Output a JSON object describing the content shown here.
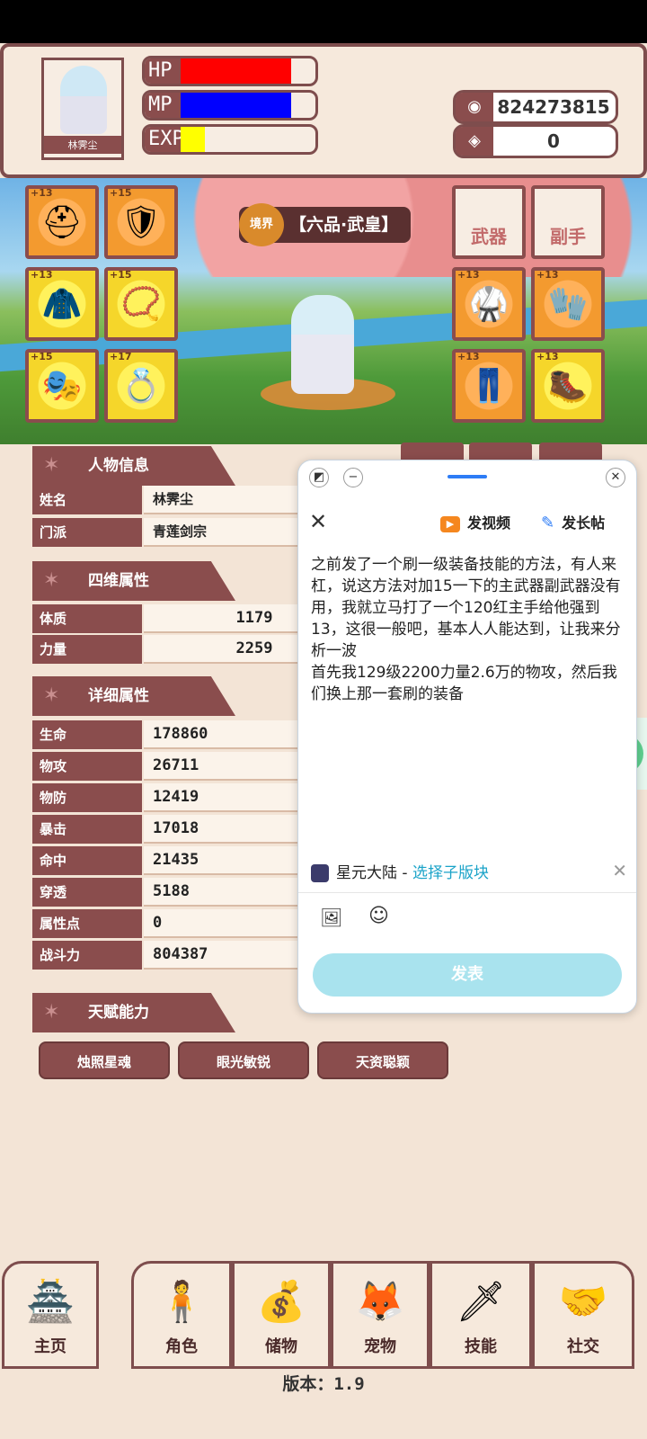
{
  "player": {
    "name": "林霁尘",
    "hp_fill": 0.82,
    "mp_fill": 0.82,
    "exp_fill": 0.18,
    "bars": {
      "hp": "HP",
      "mp": "MP",
      "exp": "EXP"
    }
  },
  "currency": {
    "gold": "824273815",
    "gems": "0"
  },
  "equipment": {
    "left": [
      {
        "plus": "+13",
        "icon": "helmet-icon",
        "glyph": "⛑"
      },
      {
        "plus": "+15",
        "icon": "pauldron-icon",
        "glyph": "🛡"
      },
      {
        "plus": "+13",
        "icon": "cape-icon",
        "glyph": "🧥"
      },
      {
        "plus": "+15",
        "icon": "necklace-icon",
        "glyph": "📿"
      },
      {
        "plus": "+15",
        "icon": "mask-icon",
        "glyph": "🎭"
      },
      {
        "plus": "+17",
        "icon": "ring-icon",
        "glyph": "💍"
      }
    ],
    "weapon_label": "武器",
    "offhand_label": "副手",
    "right": [
      {
        "plus": "+13",
        "icon": "armor-icon",
        "glyph": "🥋"
      },
      {
        "plus": "+13",
        "icon": "bracers-icon",
        "glyph": "🧤"
      },
      {
        "plus": "+13",
        "icon": "leggings-icon",
        "glyph": "👖"
      },
      {
        "plus": "+13",
        "icon": "boots-icon",
        "glyph": "🥾"
      }
    ]
  },
  "rank": {
    "badge": "境界",
    "text": "【六品·武皇】"
  },
  "info": {
    "title": "人物信息",
    "rows": [
      {
        "k": "姓名",
        "v": "林霁尘"
      },
      {
        "k": "门派",
        "v": "青莲剑宗"
      }
    ]
  },
  "four": {
    "title": "四维属性",
    "rows": [
      {
        "k": "体质",
        "v": "1179"
      },
      {
        "k": "力量",
        "v": "2259"
      }
    ]
  },
  "detail": {
    "title": "详细属性",
    "rows": [
      {
        "k": "生命",
        "v": "178860"
      },
      {
        "k": "物攻",
        "v": "26711"
      },
      {
        "k": "物防",
        "v": "12419"
      },
      {
        "k": "暴击",
        "v": "17018"
      },
      {
        "k": "命中",
        "v": "21435"
      },
      {
        "k": "穿透",
        "v": "5188"
      },
      {
        "k": "属性点",
        "v": "0"
      },
      {
        "k": "战斗力",
        "v": "804387"
      }
    ]
  },
  "talent": {
    "title": "天赋能力",
    "items": [
      "烛照星魂",
      "眼光敏锐",
      "天资聪颖"
    ]
  },
  "nav": [
    {
      "label": "主页",
      "icon": "home-gate-icon",
      "glyph": "🏯"
    },
    {
      "label": "角色",
      "icon": "character-figure-icon",
      "glyph": "🧍"
    },
    {
      "label": "储物",
      "icon": "bag-icon",
      "glyph": "💰"
    },
    {
      "label": "宠物",
      "icon": "fox-pet-icon",
      "glyph": "🦊"
    },
    {
      "label": "技能",
      "icon": "sword-icon",
      "glyph": "🗡"
    },
    {
      "label": "社交",
      "icon": "handshake-icon",
      "glyph": "🤝"
    }
  ],
  "version": "版本：1.9",
  "popup": {
    "video": "发视频",
    "long": "发长帖",
    "text": "之前发了一个刷一级装备技能的方法，有人来杠，说这方法对加15一下的主武器副武器没有用，我就立马打了一个120红主手给他强到13，这很一般吧，基本人人能达到，让我来分析一波\n首先我129级2200力量2.6万的物攻，然后我们换上那一套刷的装备",
    "forum": "星元大陆",
    "sep": " - ",
    "sub": "选择子版块",
    "send": "发表"
  }
}
